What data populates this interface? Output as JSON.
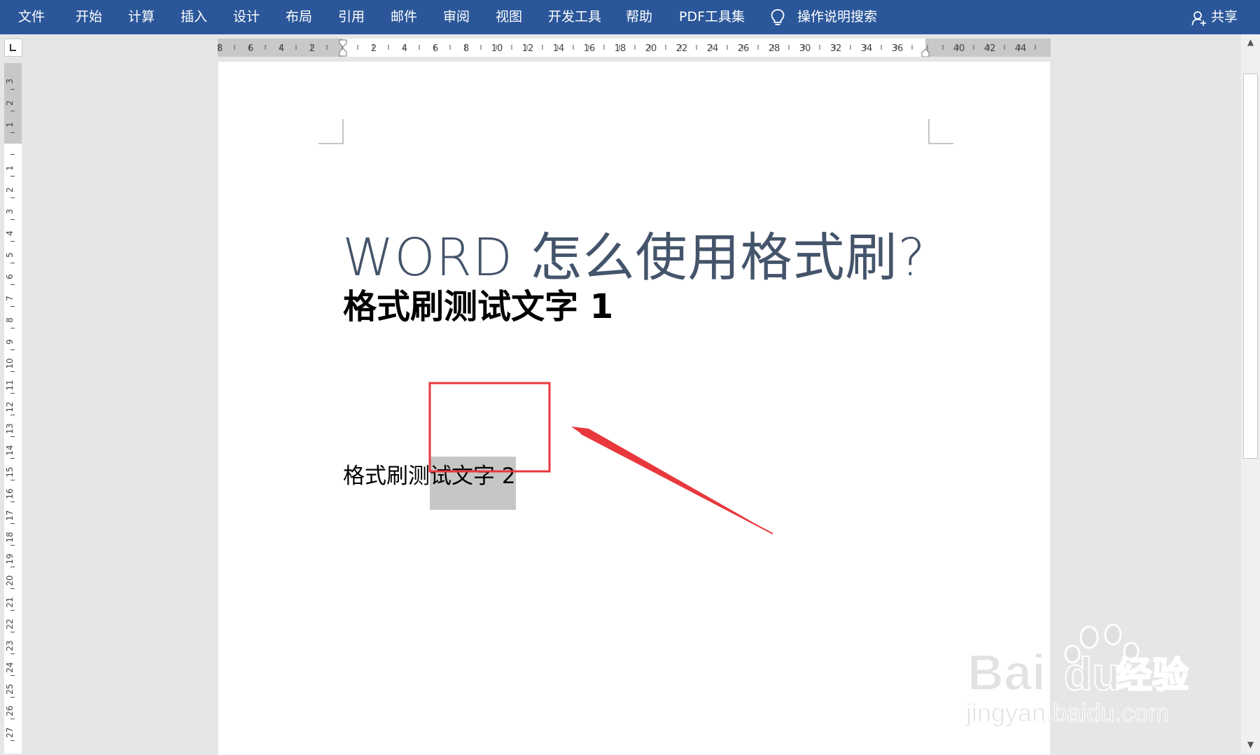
{
  "ribbon": {
    "tabs": [
      {
        "key": "file",
        "label": "文件"
      },
      {
        "key": "home",
        "label": "开始"
      },
      {
        "key": "calc",
        "label": "计算"
      },
      {
        "key": "insert",
        "label": "插入"
      },
      {
        "key": "design",
        "label": "设计"
      },
      {
        "key": "layout",
        "label": "布局"
      },
      {
        "key": "references",
        "label": "引用"
      },
      {
        "key": "mailings",
        "label": "邮件"
      },
      {
        "key": "review",
        "label": "审阅"
      },
      {
        "key": "view",
        "label": "视图"
      },
      {
        "key": "developer",
        "label": "开发工具"
      },
      {
        "key": "help",
        "label": "帮助"
      },
      {
        "key": "pdf",
        "label": "PDF工具集"
      }
    ],
    "tell_me": "操作说明搜索",
    "share": "共享"
  },
  "hruler": {
    "labels": [
      "8",
      "6",
      "4",
      "2",
      "2",
      "4",
      "6",
      "8",
      "10",
      "12",
      "14",
      "16",
      "18",
      "20",
      "22",
      "24",
      "26",
      "28",
      "30",
      "32",
      "34",
      "36",
      "40",
      "42",
      "44"
    ]
  },
  "vruler": {
    "labels_top": [
      "3",
      "2",
      "1"
    ],
    "labels": [
      "1",
      "2",
      "3",
      "4",
      "5",
      "6",
      "7",
      "8",
      "9",
      "10",
      "11",
      "12",
      "13",
      "14",
      "15",
      "16",
      "17",
      "18",
      "19",
      "20",
      "21",
      "22",
      "23",
      "24",
      "25",
      "26",
      "27"
    ]
  },
  "document": {
    "title": "WORD 怎么使用格式刷?",
    "heading1": "格式刷测试文字 1",
    "line2_plain": "格式刷测",
    "line2_selected": "试文字 2"
  },
  "watermark": {
    "brand": "Bai",
    "brand2": "du",
    "brand_cn": "经验",
    "url": "jingyan.baidu.com"
  },
  "colors": {
    "ribbon": "#2b579a",
    "title": "#44546a",
    "annotation": "#e8383d",
    "selection": "#c6c6c6"
  }
}
